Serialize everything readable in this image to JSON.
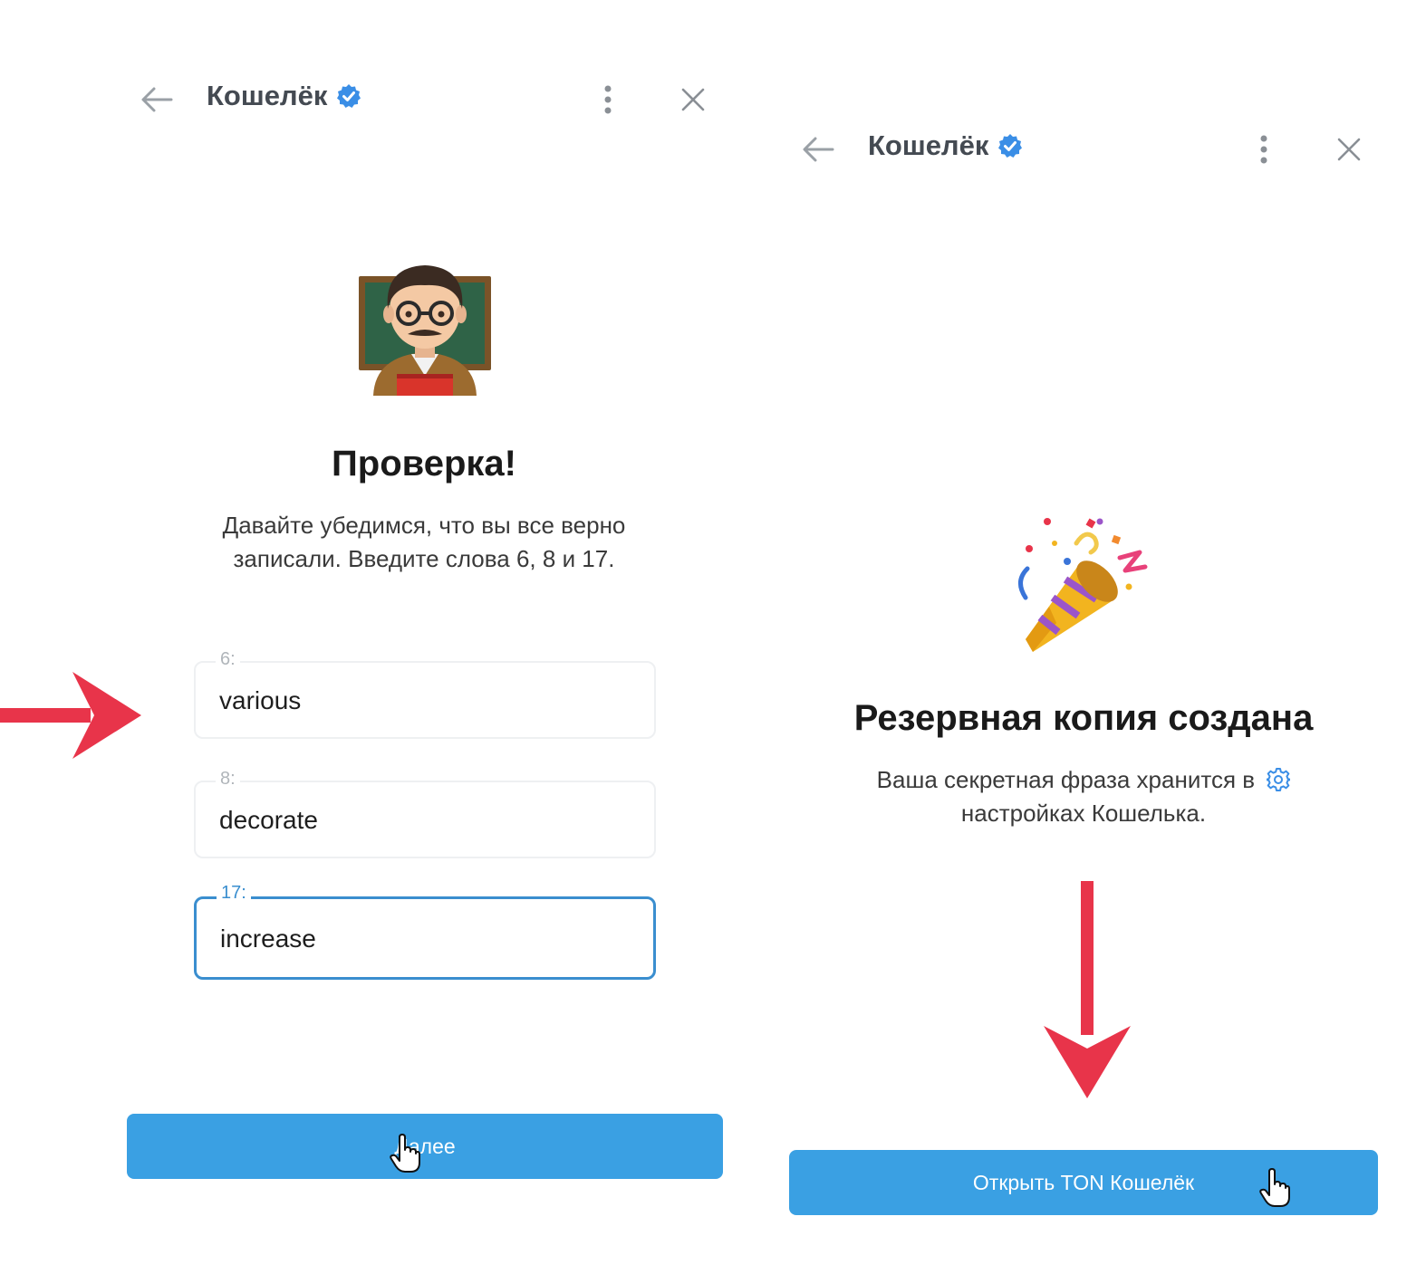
{
  "left": {
    "header": {
      "title": "Кошелёк"
    },
    "heading": "Проверка!",
    "description_line1": "Давайте убедимся, что вы все верно",
    "description_line2": "записали. Введите слова 6, 8 и 17.",
    "fields": [
      {
        "label": "6:",
        "value": "various"
      },
      {
        "label": "8:",
        "value": "decorate"
      },
      {
        "label": "17:",
        "value": "increase"
      }
    ],
    "next_button": "Далее"
  },
  "right": {
    "header": {
      "title": "Кошелёк"
    },
    "heading": "Резервная копия создана",
    "description_line1": "Ваша секретная фраза хранится в",
    "description_line2": "настройках Кошелька.",
    "open_button": "Открыть TON Кошелёк"
  },
  "colors": {
    "accent": "#3aa0e3",
    "arrow": "#e8344a",
    "verified": "#3a8ee6",
    "focus_border": "#3a8ecf"
  },
  "icons": [
    "back-arrow-icon",
    "verified-badge-icon",
    "more-vertical-icon",
    "close-icon",
    "teacher-emoji-icon",
    "party-popper-icon",
    "settings-gear-icon",
    "hand-cursor-icon",
    "red-arrow-icon"
  ]
}
